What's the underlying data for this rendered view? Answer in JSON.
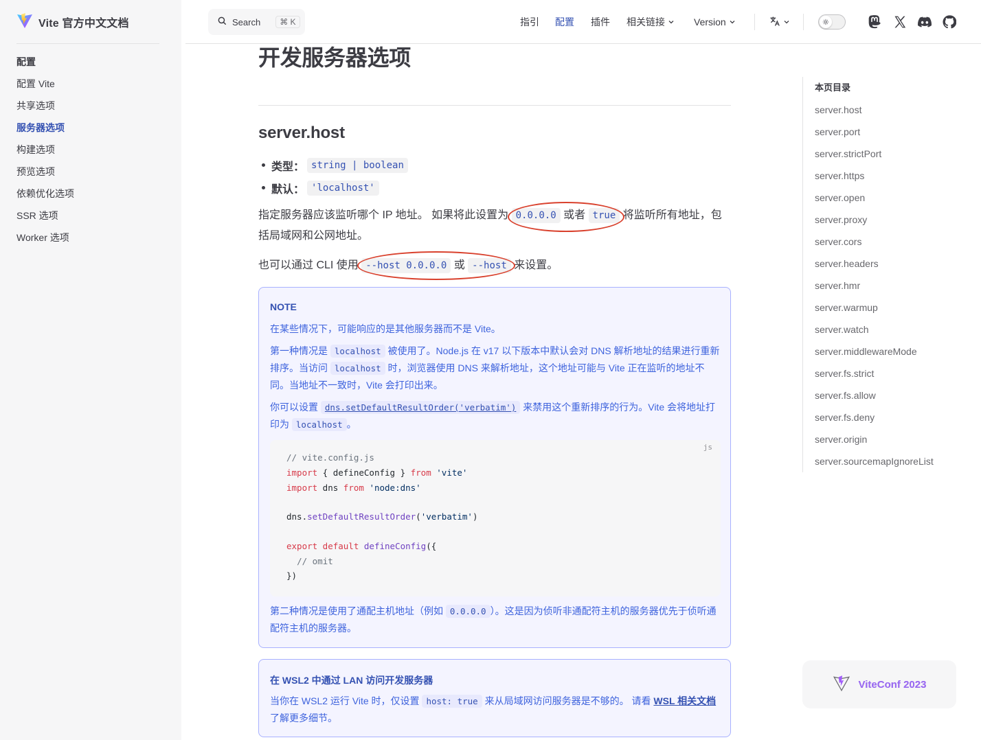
{
  "brand": {
    "title": "Vite 官方中文文档",
    "logo": "vite-logo-icon"
  },
  "sidebar": {
    "heading": "配置",
    "items": [
      {
        "label": "配置 Vite",
        "active": false
      },
      {
        "label": "共享选项",
        "active": false
      },
      {
        "label": "服务器选项",
        "active": true
      },
      {
        "label": "构建选项",
        "active": false
      },
      {
        "label": "预览选项",
        "active": false
      },
      {
        "label": "依赖优化选项",
        "active": false
      },
      {
        "label": "SSR 选项",
        "active": false
      },
      {
        "label": "Worker 选项",
        "active": false
      }
    ]
  },
  "topbar": {
    "search_label": "Search",
    "search_shortcut": "⌘ K",
    "nav": [
      {
        "label": "指引"
      },
      {
        "label": "配置",
        "active": true
      },
      {
        "label": "插件"
      },
      {
        "label": "相关链接",
        "dropdown": true
      },
      {
        "label": "Version",
        "dropdown": true
      }
    ],
    "icons": [
      "translate-icon",
      "theme-toggle",
      "mastodon-icon",
      "x-icon",
      "discord-icon",
      "github-icon"
    ]
  },
  "main": {
    "page_title": "开发服务器选项",
    "section_title": "server.host",
    "type_label": "类型：",
    "type_value": "string | boolean",
    "default_label": "默认：",
    "default_value": "'localhost'",
    "p1_a": "指定服务器应该监听哪个 IP 地址。 如果将此设置为 ",
    "p1_code1": "0.0.0.0",
    "p1_b": " 或者 ",
    "p1_code2": "true",
    "p1_c": " 将监听所有地址，包括局域网和公网地址。",
    "p2_a": "也可以通过 CLI 使用 ",
    "p2_code1": "--host 0.0.0.0",
    "p2_b": " 或 ",
    "p2_code2": "--host",
    "p2_c": " 来设置。",
    "note": {
      "title": "NOTE",
      "p1": "在某些情况下，可能响应的是其他服务器而不是 Vite。",
      "p2_a": "第一种情况是 ",
      "p2_code1": "localhost",
      "p2_b": " 被使用了。Node.js 在 v17 以下版本中默认会对 DNS 解析地址的结果进行重新排序。当访问 ",
      "p2_code2": "localhost",
      "p2_c": " 时，浏览器使用 DNS 来解析地址，这个地址可能与 Vite 正在监听的地址不同。当地址不一致时，Vite 会打印出来。",
      "p3_a": "你可以设置 ",
      "p3_link": "dns.setDefaultResultOrder('verbatim')",
      "p3_b": " 来禁用这个重新排序的行为。Vite 会将地址打印为 ",
      "p3_code": "localhost",
      "p3_c": "。",
      "code_lang": "js",
      "p4_a": "第二种情况是使用了通配主机地址（例如 ",
      "p4_code": "0.0.0.0",
      "p4_b": "）。这是因为侦听非通配符主机的服务器优先于侦听通配符主机的服务器。"
    },
    "wsl": {
      "title": "在 WSL2 中通过 LAN 访问开发服务器",
      "p_a": "当你在 WSL2 运行 Vite 时，仅设置 ",
      "p_code": "host: true",
      "p_b": " 来从局域网访问服务器是不够的。 请看 ",
      "p_link": "WSL 相关文档",
      "p_c": " 了解更多细节。"
    }
  },
  "toc": {
    "heading": "本页目录",
    "items": [
      "server.host",
      "server.port",
      "server.strictPort",
      "server.https",
      "server.open",
      "server.proxy",
      "server.cors",
      "server.headers",
      "server.hmr",
      "server.warmup",
      "server.watch",
      "server.middlewareMode",
      "server.fs.strict",
      "server.fs.allow",
      "server.fs.deny",
      "server.origin",
      "server.sourcemapIgnoreList"
    ]
  },
  "promo": {
    "label": "ViteConf 2023"
  },
  "colors": {
    "brand": "#3451b2",
    "annotation": "#d9412d",
    "note_border": "#a8b1ff",
    "note_bg": "#f4f4ff"
  }
}
